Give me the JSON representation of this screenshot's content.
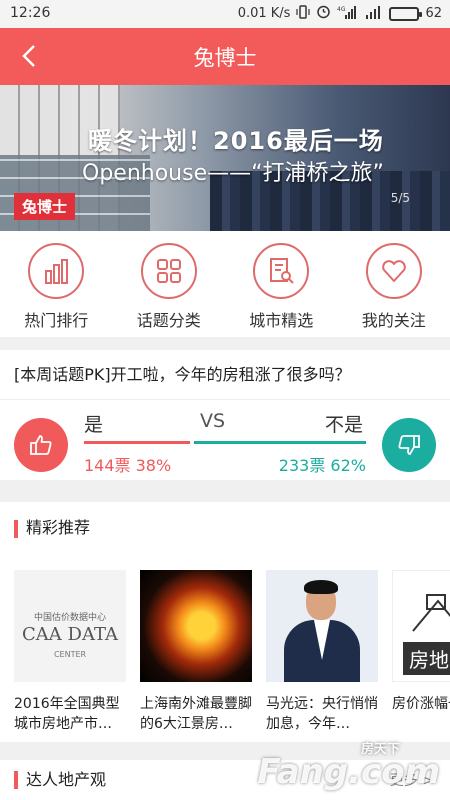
{
  "status_bar": {
    "time": "12:26",
    "speed": "0.01 K/s",
    "network": "4G",
    "battery_level": "62",
    "battery_fraction": 0.62,
    "battery_color": "#f0a500"
  },
  "nav": {
    "title": "兔博士",
    "back_icon": "chevron-left-icon",
    "bg_color": "#f35b5b"
  },
  "banner": {
    "headline": "暖冬计划！2016最后一场",
    "subline": "Openhouse——“打浦桥之旅”",
    "logo": "兔博士",
    "pager": "5/5"
  },
  "categories": [
    {
      "label": "热门排行",
      "icon": "bar-chart-icon"
    },
    {
      "label": "话题分类",
      "icon": "grid-icon"
    },
    {
      "label": "城市精选",
      "icon": "document-search-icon"
    },
    {
      "label": "我的关注",
      "icon": "heart-icon"
    }
  ],
  "topic": {
    "question": "[本周话题PK]开工啦，今年的房租涨了很多吗？",
    "yes_label": "是",
    "vs_label": "VS",
    "no_label": "不是",
    "yes_stat": "144票 38%",
    "no_stat": "233票 62%",
    "yes_fraction": 0.38,
    "no_fraction": 0.62,
    "yes_color": "#f05a5a",
    "no_color": "#1aada0"
  },
  "recommend": {
    "title": "精彩推荐",
    "cards": [
      {
        "title": "2016年全国典型城市房地产市…",
        "thumb_small": "中国估价数据中心",
        "thumb_big": "CAA DATA",
        "thumb_sub": "CENTER"
      },
      {
        "title": "上海南外滩最豐脚的6大江景房…"
      },
      {
        "title": "马光远：央行悄悄加息，今年…"
      },
      {
        "title": "房价涨幅一的城市",
        "thumb_label": "房地"
      }
    ]
  },
  "expert": {
    "title": "达人地产观",
    "more": "更多 >"
  },
  "watermark": {
    "top": "房天下",
    "main": "Fang.com"
  }
}
